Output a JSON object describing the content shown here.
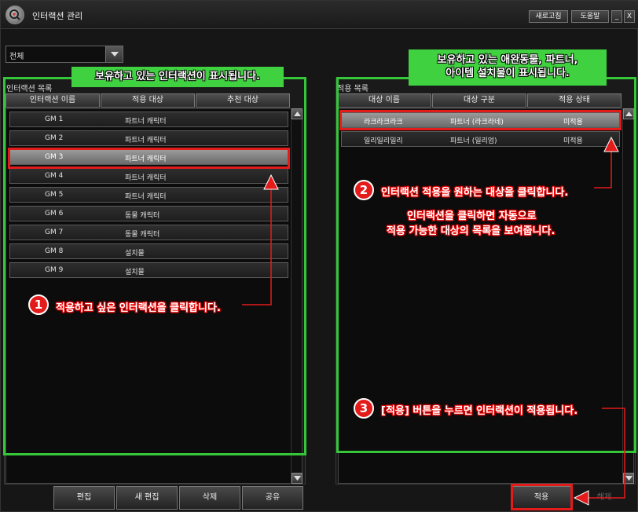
{
  "window": {
    "title": "인터랙션 관리",
    "refresh_label": "새로고침",
    "help_label": "도움말",
    "minimize_label": "_",
    "close_label": "X"
  },
  "filter": {
    "selected": "전체"
  },
  "left_panel": {
    "title": "인터랙션 목록",
    "columns": [
      "인터랙션 이름",
      "적용 대상",
      "추천 대상"
    ],
    "rows": [
      {
        "name": "GM 1",
        "target": "파트너 캐릭터"
      },
      {
        "name": "GM 2",
        "target": "파트너 캐릭터"
      },
      {
        "name": "GM 3",
        "target": "파트너 캐릭터"
      },
      {
        "name": "GM 4",
        "target": "파트너 캐릭터"
      },
      {
        "name": "GM 5",
        "target": "파트너 캐릭터"
      },
      {
        "name": "GM 6",
        "target": "동물 캐릭터"
      },
      {
        "name": "GM 7",
        "target": "동물 캐릭터"
      },
      {
        "name": "GM 8",
        "target": "설치물"
      },
      {
        "name": "GM 9",
        "target": "설치물"
      }
    ],
    "buttons": {
      "edit": "편집",
      "new_edit": "새 편집",
      "delete": "삭제",
      "share": "공유"
    }
  },
  "right_panel": {
    "title": "적용 목록",
    "columns": [
      "대상 이름",
      "대상 구분",
      "적용 상태"
    ],
    "rows": [
      {
        "name": "라크라크라크",
        "type": "파트너 (라크라네)",
        "status": "미적용"
      },
      {
        "name": "일리일리일리",
        "type": "파트너 (일리엄)",
        "status": "미적용"
      }
    ],
    "buttons": {
      "apply": "적용",
      "release": "해제"
    }
  },
  "annotations": {
    "left_banner": "보유하고 있는 인터랙션이 표시됩니다.",
    "right_banner_line1": "보유하고 있는 애완동물, 파트너,",
    "right_banner_line2": "아이템 설치물이 표시됩니다.",
    "step1_num": "1",
    "step1": "적용하고 싶은 인터랙션을 클릭합니다.",
    "step2_num": "2",
    "step2": "인터랙션 적용을 원하는 대상을 클릭합니다.",
    "step2_note1": "인터랙션을 클릭하면 자동으로",
    "step2_note2": "적용 가능한 대상의 목록을 보여줍니다.",
    "step3_num": "3",
    "step3": "[적용] 버튼을 누르면 인터랙션이 적용됩니다."
  },
  "colors": {
    "accent_green": "#3fd13f",
    "accent_red": "#e31b1b"
  }
}
